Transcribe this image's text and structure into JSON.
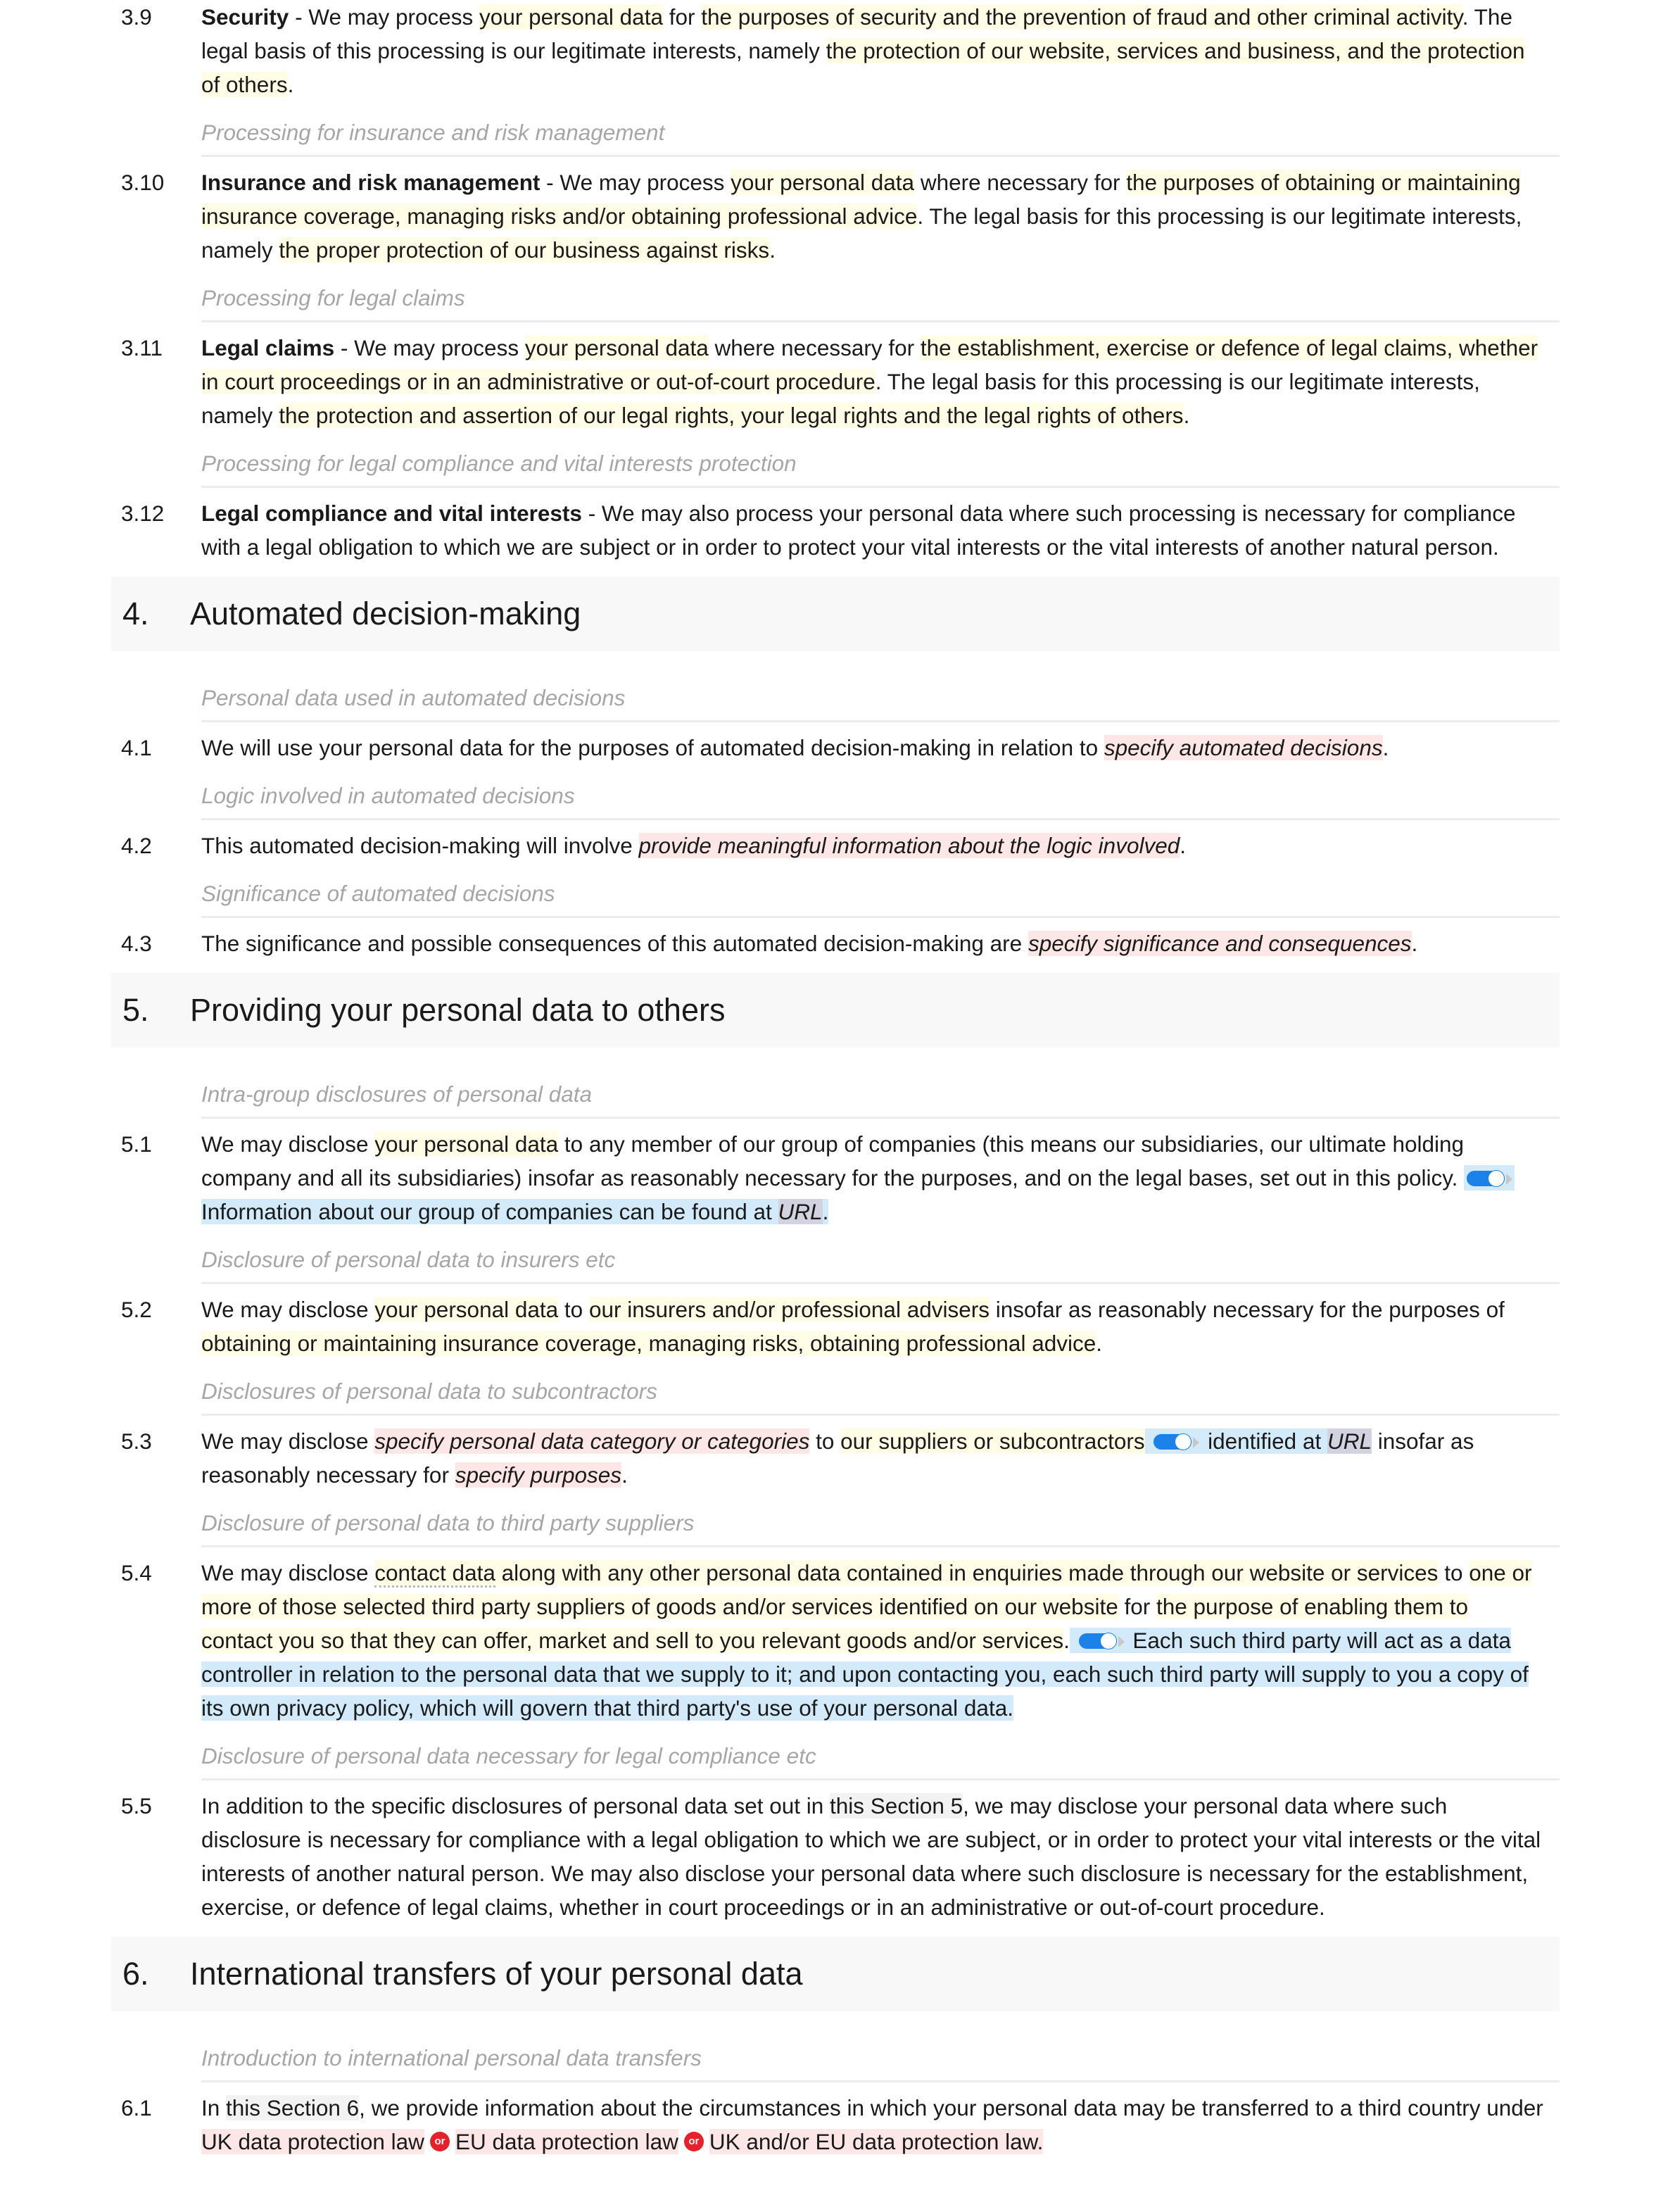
{
  "document": {
    "clauses_3": [
      {
        "num": "3.9",
        "title": "Security",
        "parts": [
          " - We may process ",
          "your personal data",
          " for ",
          "the purposes of security and the prevention of fraud and other criminal activity",
          ". The legal basis of this processing is our legitimate interests, namely ",
          "the protection of our website, services and business, and the protection of others",
          "."
        ]
      },
      {
        "subheading": "Processing for insurance and risk management",
        "num": "3.10",
        "title": "Insurance and risk management",
        "parts": [
          " - We may process ",
          "your personal data",
          " where necessary for ",
          "the purposes of obtaining or maintaining insurance coverage, managing risks and/or obtaining professional advice",
          ". The legal basis for this processing is our legitimate interests, namely ",
          "the proper protection of our business against risks",
          "."
        ]
      },
      {
        "subheading": "Processing for legal claims",
        "num": "3.11",
        "title": "Legal claims",
        "parts": [
          " - We may process ",
          "your personal data",
          " where necessary for ",
          "the establishment, exercise or defence of legal claims, whether in court proceedings or in an administrative or out-of-court procedure",
          ". The legal basis for this processing is our legitimate interests, namely ",
          "the protection and assertion of our legal rights, your legal rights and the legal rights of others",
          "."
        ]
      },
      {
        "subheading": "Processing for legal compliance and vital interests protection",
        "num": "3.12",
        "title": "Legal compliance and vital interests",
        "text": " - We may also process your personal data where such processing is necessary for compliance with a legal obligation to which we are subject or in order to protect your vital interests or the vital interests of another natural person."
      }
    ],
    "section_4": {
      "num": "4.",
      "title": "Automated decision-making",
      "clauses": [
        {
          "subheading": "Personal data used in automated decisions",
          "num": "4.1",
          "text": "We will use your personal data for the purposes of automated decision-making in relation to ",
          "placeholder": "specify automated decisions",
          "end": "."
        },
        {
          "subheading": "Logic involved in automated decisions",
          "num": "4.2",
          "text": "This automated decision-making will involve ",
          "placeholder": "provide meaningful information about the logic involved",
          "end": "."
        },
        {
          "subheading": "Significance of automated decisions",
          "num": "4.3",
          "text": "The significance and possible consequences of this automated decision-making are ",
          "placeholder": "specify significance and consequences",
          "end": "."
        }
      ]
    },
    "section_5": {
      "num": "5.",
      "title": "Providing your personal data to others",
      "c1": {
        "subheading": "Intra-group disclosures of personal data",
        "num": "5.1",
        "a": "We may disclose ",
        "b": "your personal data",
        "c": " to any member of our group of companies (this means our subsidiaries, our ultimate holding company and all its subsidiaries) insofar as reasonably necessary for the purposes, and on the legal bases, set out in this policy. ",
        "optional": " Information about our group of companies can be found at ",
        "url": "URL",
        "end": "."
      },
      "c2": {
        "subheading": "Disclosure of personal data to insurers etc",
        "num": "5.2",
        "a": "We may disclose ",
        "b": "your personal data",
        "c": " to ",
        "d": "our insurers and/or professional advisers",
        "e": " insofar as reasonably necessary for the purposes of ",
        "f": "obtaining or maintaining insurance coverage, managing risks, obtaining professional advice",
        "end": "."
      },
      "c3": {
        "subheading": "Disclosures of personal data to subcontractors",
        "num": "5.3",
        "a": "We may disclose ",
        "placeholder1": "specify personal data category or categories",
        "b": " to ",
        "c": "our suppliers or subcontractors",
        "optional": " identified at ",
        "url": "URL",
        "d": " insofar as reasonably necessary for ",
        "placeholder2": "specify purposes",
        "end": "."
      },
      "c4": {
        "subheading": "Disclosure of personal data to third party suppliers",
        "num": "5.4",
        "a": "We may disclose ",
        "b_defined": "contact data",
        "b_rest": " along with any other personal data contained in enquiries made through our website or services",
        "c": " to ",
        "d": "one or more of those selected third party suppliers of goods and/or services identified on our website",
        "e": " for ",
        "f": "the purpose of enabling them to contact you so that they can offer, market and sell to you relevant goods and/or services",
        "g": ".",
        "optional": " Each such third party will act as a data controller in relation to the personal data that we supply to it; and upon contacting you, each such third party will supply to you a copy of its own privacy policy, which will govern that third party's use of your personal data."
      },
      "c5": {
        "subheading": "Disclosure of personal data necessary for legal compliance etc",
        "num": "5.5",
        "a": "In addition to the specific disclosures of personal data set out in ",
        "xref": "this Section 5",
        "b": ", we may disclose your personal data where such disclosure is necessary for compliance with a legal obligation to which we are subject, or in order to protect your vital interests or the vital interests of another natural person. We may also disclose your personal data where such disclosure is necessary for the establishment, exercise, or defence of legal claims, whether in court proceedings or in an administrative or out-of-court procedure."
      }
    },
    "section_6": {
      "num": "6.",
      "title": "International transfers of your personal data",
      "c1": {
        "subheading": "Introduction to international personal data transfers",
        "num": "6.1",
        "a": "In ",
        "xref": "this Section 6",
        "b": ", we provide information about the circumstances in which your personal data may be transferred to a third country under ",
        "option1": "UK data protection law",
        "option2": "EU data protection law",
        "option3": "UK and/or EU data protection law",
        "or_label": "or",
        "end": "."
      }
    }
  }
}
